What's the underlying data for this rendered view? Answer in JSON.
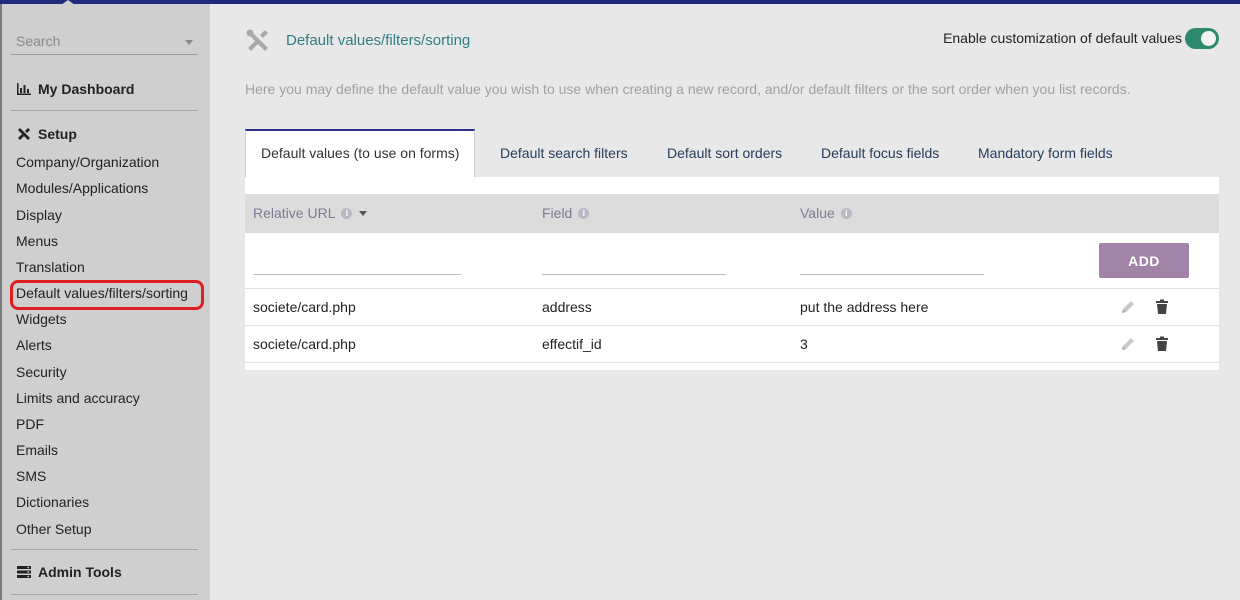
{
  "sidebar": {
    "search_placeholder": "Search",
    "dashboard_label": "My Dashboard",
    "setup_label": "Setup",
    "items": [
      {
        "label": "Company/Organization"
      },
      {
        "label": "Modules/Applications"
      },
      {
        "label": "Display"
      },
      {
        "label": "Menus"
      },
      {
        "label": "Translation"
      },
      {
        "label": "Default values/filters/sorting"
      },
      {
        "label": "Widgets"
      },
      {
        "label": "Alerts"
      },
      {
        "label": "Security"
      },
      {
        "label": "Limits and accuracy"
      },
      {
        "label": "PDF"
      },
      {
        "label": "Emails"
      },
      {
        "label": "SMS"
      },
      {
        "label": "Dictionaries"
      },
      {
        "label": "Other Setup"
      }
    ],
    "admin_tools_label": "Admin Tools",
    "highlighted_item": "Default values/filters/sorting",
    "highlight_color": "#e02020"
  },
  "header": {
    "title": "Default values/filters/sorting",
    "toggle_label": "Enable customization of default values",
    "toggle_on": true,
    "toggle_color": "#2e8a6e",
    "description": "Here you may define the default value you wish to use when creating a new record, and/or default filters or the sort order when you list records."
  },
  "tabs": [
    {
      "label": "Default values (to use on forms)",
      "active": true
    },
    {
      "label": "Default search filters"
    },
    {
      "label": "Default sort orders"
    },
    {
      "label": "Default focus fields"
    },
    {
      "label": "Mandatory form fields"
    }
  ],
  "table": {
    "columns": [
      {
        "label": "Relative URL"
      },
      {
        "label": "Field"
      },
      {
        "label": "Value"
      }
    ],
    "add_label": "ADD",
    "add_color": "#a183a8",
    "rows": [
      {
        "url": "societe/card.php",
        "field": "address",
        "value": "put the address here"
      },
      {
        "url": "societe/card.php",
        "field": "effectif_id",
        "value": "3"
      }
    ]
  },
  "icons": [
    "chart-icon",
    "tools-icon",
    "server-icon",
    "info-icon",
    "pencil-icon",
    "trash-icon",
    "caret-down-icon"
  ]
}
